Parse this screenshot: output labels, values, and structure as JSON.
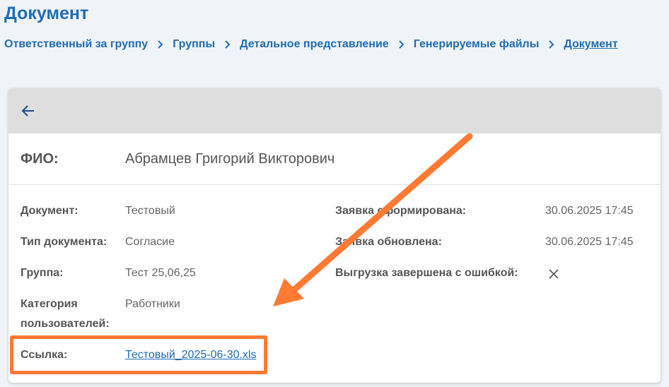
{
  "page": {
    "title": "Документ"
  },
  "breadcrumb": {
    "items": [
      {
        "label": "Ответственный за группу"
      },
      {
        "label": "Группы"
      },
      {
        "label": "Детальное представление"
      },
      {
        "label": "Генерируемые файлы"
      },
      {
        "label": "Документ"
      }
    ]
  },
  "card": {
    "fio_label": "ФИО:",
    "fio_value": "Абрамцев Григорий Викторович",
    "left_fields": [
      {
        "label": "Документ:",
        "value": "Тестовый"
      },
      {
        "label": "Тип документа:",
        "value": "Согласие"
      },
      {
        "label": "Группа:",
        "value": "Тест 25,06,25"
      },
      {
        "label": "Категория пользователей:",
        "value": "Работники"
      },
      {
        "label": "Ссылка:",
        "value": "Тестовый_2025-06-30.xls"
      }
    ],
    "right_fields": [
      {
        "label": "Заявка сформирована:",
        "value": "30.06.2025 17:45"
      },
      {
        "label": "Заявка обновлена:",
        "value": "30.06.2025 17:45"
      },
      {
        "label": "Выгрузка завершена с ошибкой:",
        "icon": "close-icon"
      }
    ]
  },
  "colors": {
    "accent": "#1f6db3",
    "annotation": "#ff7a33",
    "header_bg": "#dedede",
    "page_bg": "#f0f3f7"
  }
}
